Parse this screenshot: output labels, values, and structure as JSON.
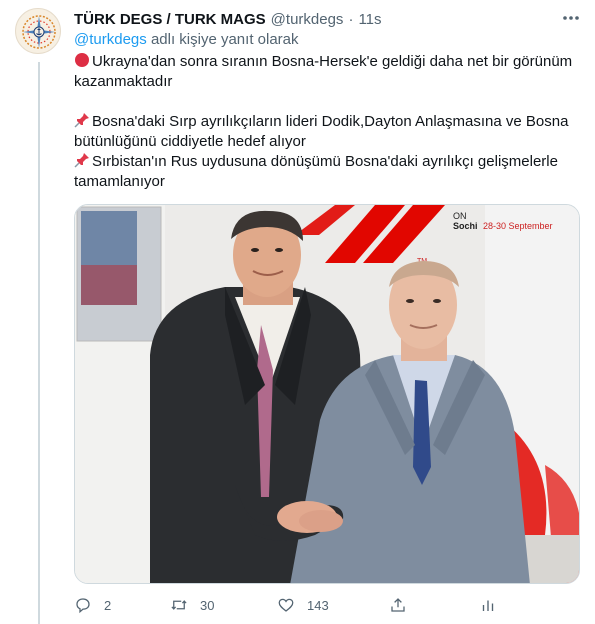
{
  "tweet": {
    "display_name": "TÜRK DEGS / TURK MAGS",
    "handle": "@turkdegs",
    "separator": "·",
    "time": "11s",
    "reply_mention": "@turkdegs",
    "reply_suffix": "adlı kişiye yanıt olarak",
    "lines": [
      "Ukrayna'dan sonra sıranın Bosna-Hersek'e geldiği daha net bir görünüm kazanmaktadır",
      "Bosna'daki Sırp ayrılıkçıların lideri Dodik,Dayton Anlaşmasına ve Bosna bütünlüğünü ciddiyetle hedef alıyor",
      "Sırbistan'ın Rus uydusuna dönüşümü Bosna'daki ayrılıkçı gelişmelerle tamamlanıyor"
    ],
    "line_icons": [
      "red-circle-icon",
      "pushpin-icon",
      "pushpin-icon"
    ]
  },
  "media": {
    "backdrop_text_1": "Sochi",
    "backdrop_text_2": "28-30 September",
    "backdrop_tm": "TM",
    "backdrop_side": "ON"
  },
  "actions": {
    "reply_count": "2",
    "retweet_count": "30",
    "like_count": "143"
  },
  "colors": {
    "link": "#1d9bf0",
    "secondary_text": "#536471",
    "brand_red": "#e10600"
  }
}
